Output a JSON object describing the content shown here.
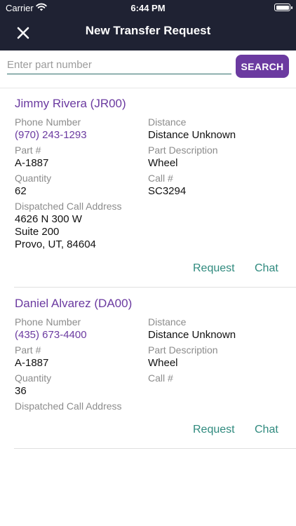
{
  "status_bar": {
    "carrier": "Carrier",
    "time": "6:44 PM"
  },
  "nav": {
    "title": "New Transfer Request"
  },
  "search": {
    "placeholder": "Enter part number",
    "value": "",
    "button_label": "SEARCH"
  },
  "labels": {
    "phone": "Phone Number",
    "distance": "Distance",
    "part": "Part #",
    "part_description": "Part Description",
    "quantity": "Quantity",
    "call": "Call #",
    "dispatched_address": "Dispatched Call Address",
    "request": "Request",
    "chat": "Chat"
  },
  "results": [
    {
      "name": "Jimmy Rivera (JR00)",
      "phone": "(970) 243-1293",
      "distance": "Distance Unknown",
      "part": "A-1887",
      "part_description": "Wheel",
      "quantity": "62",
      "call": "SC3294",
      "address_lines": [
        "4626 N 300 W",
        "Suite 200",
        "Provo, UT, 84604"
      ]
    },
    {
      "name": "Daniel Alvarez (DA00)",
      "phone": "(435) 673-4400",
      "distance": "Distance Unknown",
      "part": "A-1887",
      "part_description": "Wheel",
      "quantity": "36",
      "call": "",
      "address_lines": []
    }
  ],
  "colors": {
    "header_bg": "#1f2233",
    "accent": "#6b3aa0",
    "action": "#2f8a7e"
  },
  "icons": {
    "close": "close-icon",
    "wifi": "wifi-icon",
    "battery": "battery-icon"
  }
}
